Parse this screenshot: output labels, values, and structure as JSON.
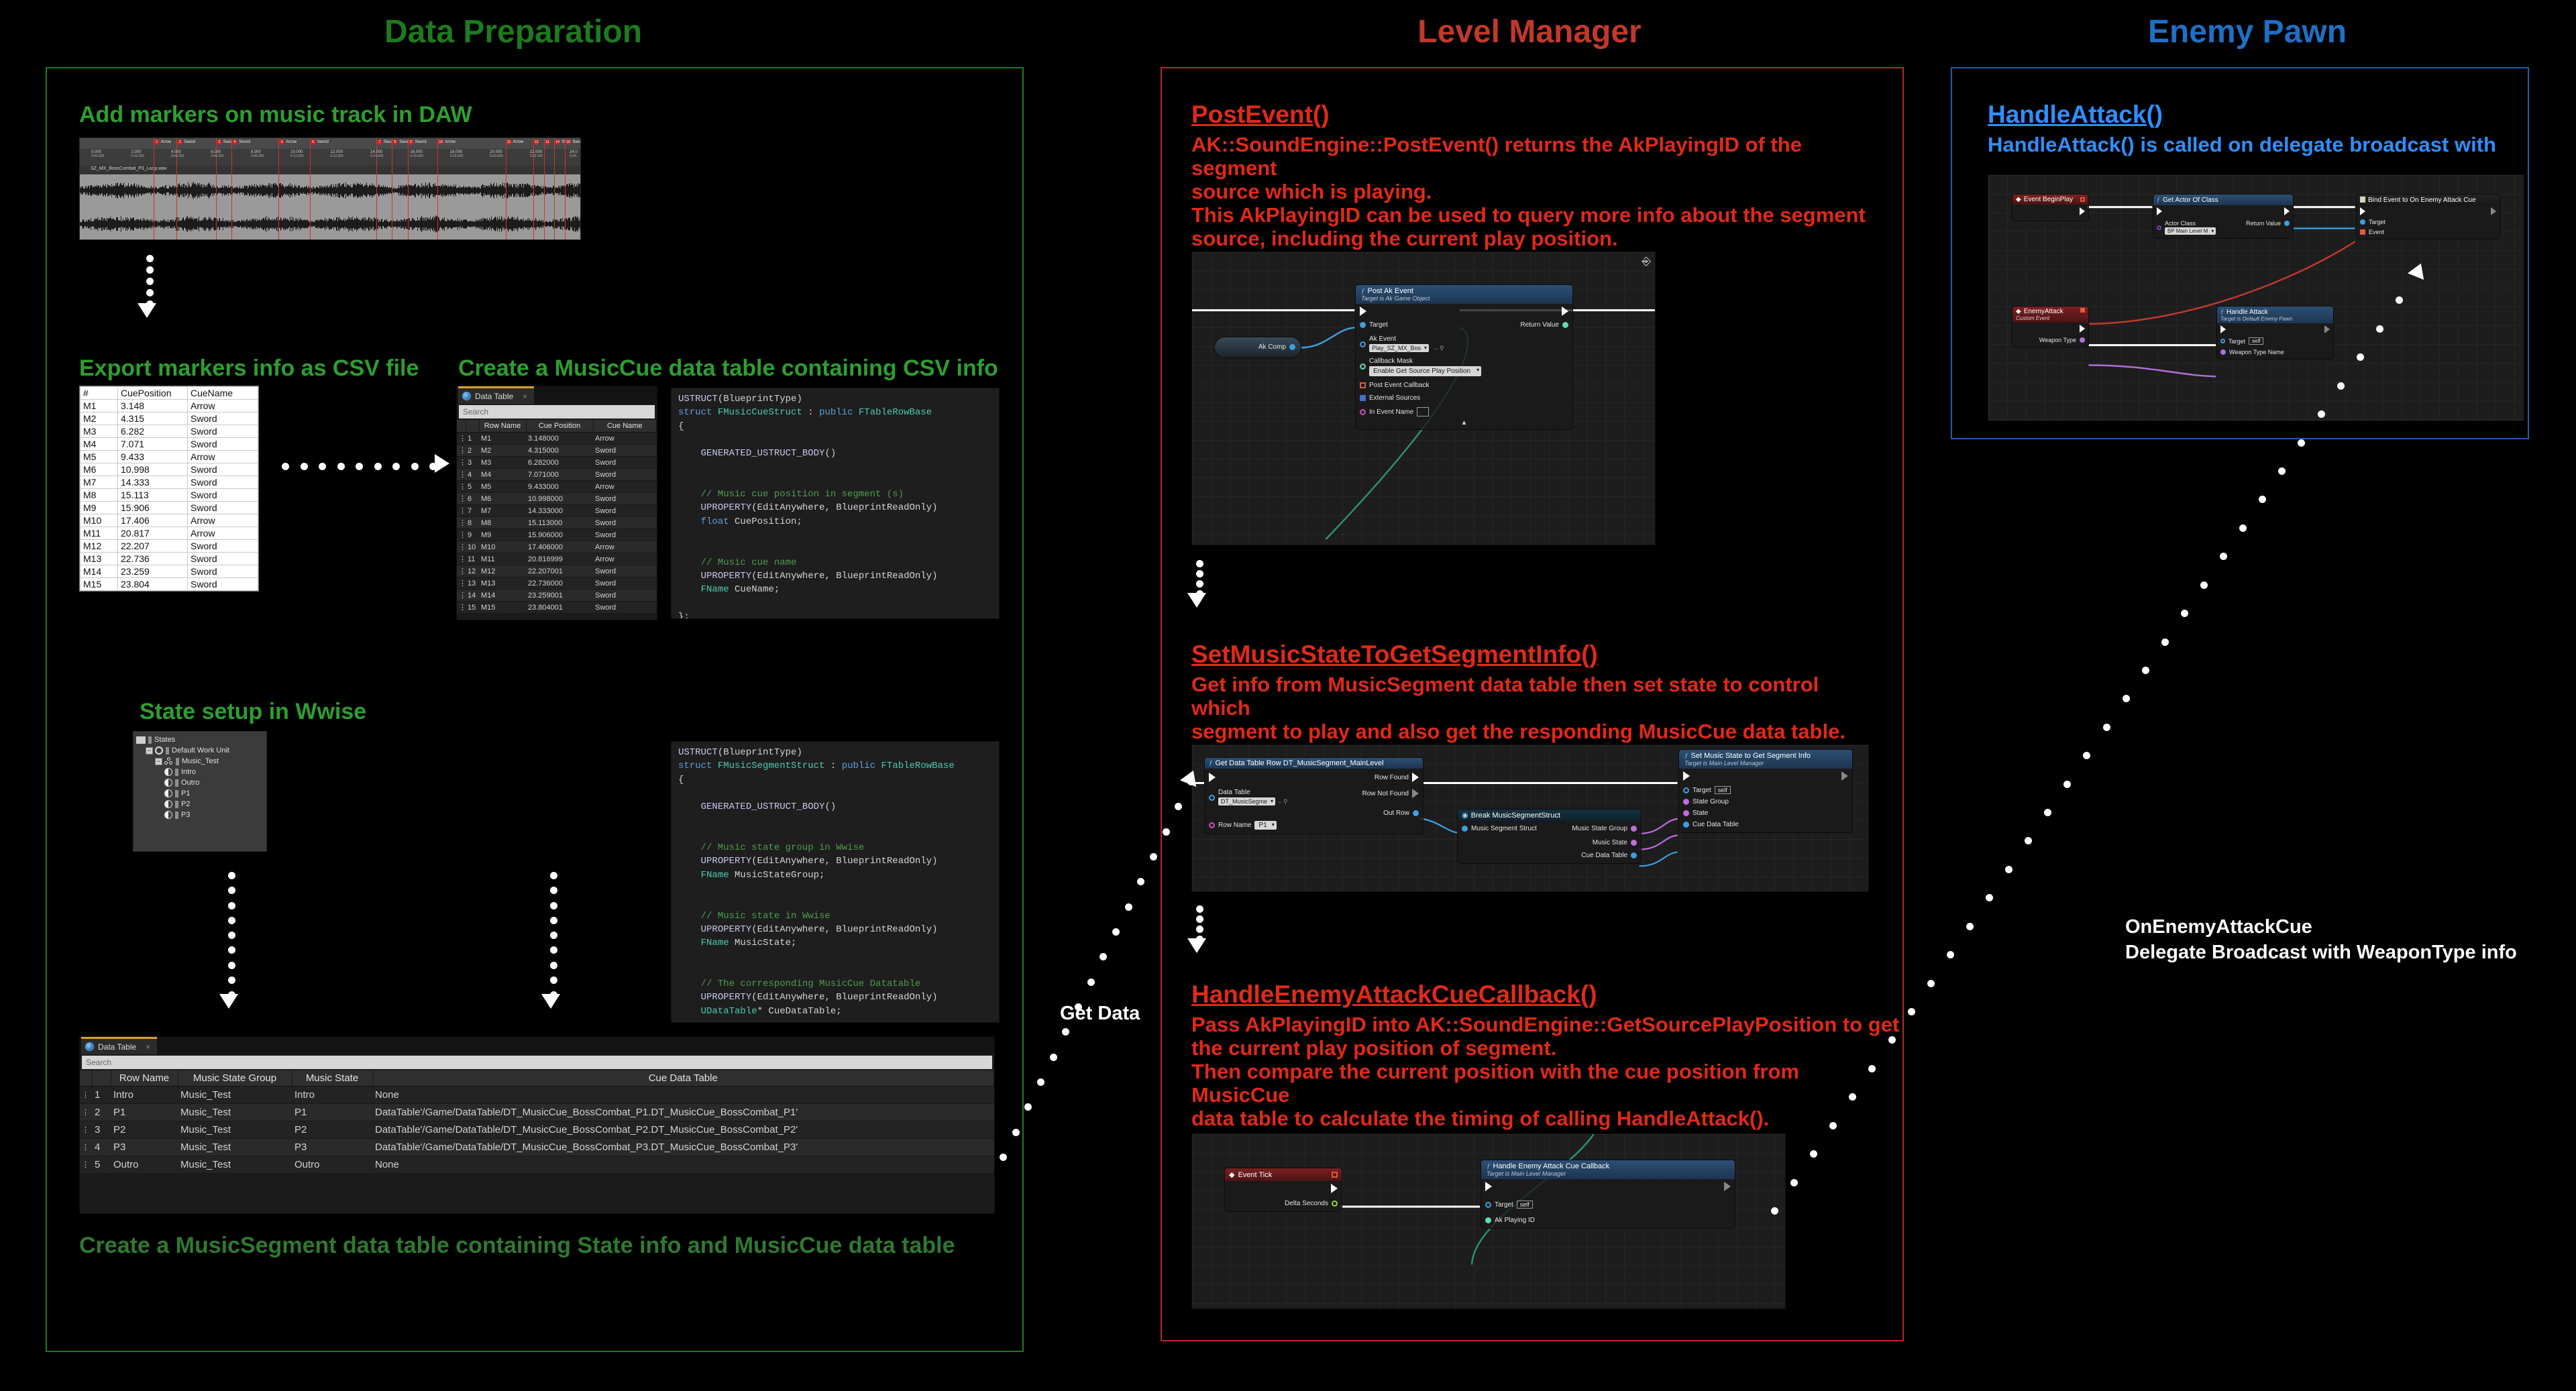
{
  "columns": {
    "data_prep": {
      "title": "Data Preparation",
      "color": "#1e7a1e"
    },
    "level_manager": {
      "title": "Level Manager",
      "color": "#c0392b"
    },
    "enemy_pawn": {
      "title": "Enemy Pawn",
      "color": "#1f6fc4"
    }
  },
  "data_prep": {
    "heading_daw": "Add markers on music track in DAW",
    "heading_export": "Export markers info as CSV file",
    "heading_create_cue_dt": "Create a MusicCue data table containing CSV info",
    "heading_state_setup": "State setup in Wwise",
    "caption_segment_dt": "Create a MusicSegment data table containing State info and MusicCue data table",
    "daw": {
      "filename": "SZ_MX_BossCombat_P3_Loop.wav",
      "time_ticks": [
        "0.000",
        "2.000",
        "4.000",
        "6.000",
        "8.000",
        "10.000",
        "12.000",
        "14.000",
        "16.000",
        "18.000",
        "20.000",
        "22.000",
        "24.0"
      ],
      "time_subticks": [
        "0:00.000",
        "0:02.000",
        "0:04.000",
        "0:06.000",
        "0:08.000",
        "0:10.000",
        "0:12.000",
        "0:14.000",
        "0:16.000",
        "0:18.000",
        "0:20.000",
        "0:22.000",
        "0:24."
      ],
      "markers": [
        {
          "n": "1",
          "name": "Arrow",
          "pos": 3.148
        },
        {
          "n": "2",
          "name": "Sword",
          "pos": 4.315
        },
        {
          "n": "3",
          "name": "Sword",
          "pos": 6.282
        },
        {
          "n": "4",
          "name": "Sword",
          "pos": 7.071
        },
        {
          "n": "5",
          "name": "Arrow",
          "pos": 9.433
        },
        {
          "n": "6",
          "name": "Sword",
          "pos": 10.998
        },
        {
          "n": "7",
          "name": "Sword",
          "pos": 14.333
        },
        {
          "n": "8",
          "name": "Sword",
          "pos": 15.113
        },
        {
          "n": "9",
          "name": "Sword",
          "pos": 15.906
        },
        {
          "n": "10",
          "name": "Arrow",
          "pos": 17.406
        },
        {
          "n": "11",
          "name": "Arrow",
          "pos": 20.817
        },
        {
          "n": "12",
          "name": "",
          "pos": 22.207
        },
        {
          "n": "13",
          "name": "",
          "pos": 22.736
        },
        {
          "n": "14",
          "name": "Sw",
          "pos": 23.259
        },
        {
          "n": "15",
          "name": "Swo",
          "pos": 23.804
        }
      ]
    },
    "csv": {
      "headers": [
        "#",
        "CuePosition",
        "CueName"
      ],
      "rows": [
        [
          "M1",
          "3.148",
          "Arrow"
        ],
        [
          "M2",
          "4.315",
          "Sword"
        ],
        [
          "M3",
          "6.282",
          "Sword"
        ],
        [
          "M4",
          "7.071",
          "Sword"
        ],
        [
          "M5",
          "9.433",
          "Arrow"
        ],
        [
          "M6",
          "10.998",
          "Sword"
        ],
        [
          "M7",
          "14.333",
          "Sword"
        ],
        [
          "M8",
          "15.113",
          "Sword"
        ],
        [
          "M9",
          "15.906",
          "Sword"
        ],
        [
          "M10",
          "17.406",
          "Arrow"
        ],
        [
          "M11",
          "20.817",
          "Arrow"
        ],
        [
          "M12",
          "22.207",
          "Sword"
        ],
        [
          "M13",
          "22.736",
          "Sword"
        ],
        [
          "M14",
          "23.259",
          "Sword"
        ],
        [
          "M15",
          "23.804",
          "Sword"
        ]
      ]
    },
    "cue_datatable": {
      "tab_label": "Data Table",
      "search_placeholder": "Search",
      "headers": [
        "Row Name",
        "Cue Position",
        "Cue Name"
      ],
      "rows": [
        [
          "1",
          "M1",
          "3.148000",
          "Arrow"
        ],
        [
          "2",
          "M2",
          "4.315000",
          "Sword"
        ],
        [
          "3",
          "M3",
          "6.282000",
          "Sword"
        ],
        [
          "4",
          "M4",
          "7.071000",
          "Sword"
        ],
        [
          "5",
          "M5",
          "9.433000",
          "Arrow"
        ],
        [
          "6",
          "M6",
          "10.998000",
          "Sword"
        ],
        [
          "7",
          "M7",
          "14.333000",
          "Sword"
        ],
        [
          "8",
          "M8",
          "15.113000",
          "Sword"
        ],
        [
          "9",
          "M9",
          "15.906000",
          "Sword"
        ],
        [
          "10",
          "M10",
          "17.406000",
          "Arrow"
        ],
        [
          "11",
          "M11",
          "20.816999",
          "Arrow"
        ],
        [
          "12",
          "M12",
          "22.207001",
          "Sword"
        ],
        [
          "13",
          "M13",
          "22.736000",
          "Sword"
        ],
        [
          "14",
          "M14",
          "23.259001",
          "Sword"
        ],
        [
          "15",
          "M15",
          "23.804001",
          "Sword"
        ]
      ]
    },
    "segment_datatable": {
      "tab_label": "Data Table",
      "search_placeholder": "Search",
      "headers": [
        "Row Name",
        "Music State Group",
        "Music State",
        "Cue Data Table"
      ],
      "rows": [
        [
          "1",
          "Intro",
          "Music_Test",
          "Intro",
          "None"
        ],
        [
          "2",
          "P1",
          "Music_Test",
          "P1",
          "DataTable'/Game/DataTable/DT_MusicCue_BossCombat_P1.DT_MusicCue_BossCombat_P1'"
        ],
        [
          "3",
          "P2",
          "Music_Test",
          "P2",
          "DataTable'/Game/DataTable/DT_MusicCue_BossCombat_P2.DT_MusicCue_BossCombat_P2'"
        ],
        [
          "4",
          "P3",
          "Music_Test",
          "P3",
          "DataTable'/Game/DataTable/DT_MusicCue_BossCombat_P3.DT_MusicCue_BossCombat_P3'"
        ],
        [
          "5",
          "Outro",
          "Music_Test",
          "Outro",
          "None"
        ]
      ]
    },
    "wwise_tree": [
      {
        "label": "States",
        "icon": "folder-icon",
        "depth": 0
      },
      {
        "label": "Default Work Unit",
        "icon": "work-unit-icon",
        "depth": 1
      },
      {
        "label": "Music_Test",
        "icon": "state-group-icon",
        "depth": 2
      },
      {
        "label": "Intro",
        "icon": "state-icon",
        "depth": 3
      },
      {
        "label": "Outro",
        "icon": "state-icon",
        "depth": 3
      },
      {
        "label": "P1",
        "icon": "state-icon",
        "depth": 3
      },
      {
        "label": "P2",
        "icon": "state-icon",
        "depth": 3
      },
      {
        "label": "P3",
        "icon": "state-icon",
        "depth": 3
      }
    ],
    "code_cue_struct": "USTRUCT(BlueprintType)\nstruct FMusicCueStruct : public FTableRowBase\n{\n\n    GENERATED_USTRUCT_BODY()\n\n\n    // Music cue position in segment (s)\n    UPROPERTY(EditAnywhere, BlueprintReadOnly)\n    float CuePosition;\n\n\n    // Music cue name\n    UPROPERTY(EditAnywhere, BlueprintReadOnly)\n    FName CueName;\n\n};",
    "code_segment_struct": "USTRUCT(BlueprintType)\nstruct FMusicSegmentStruct : public FTableRowBase\n{\n\n    GENERATED_USTRUCT_BODY()\n\n\n    // Music state group in Wwise\n    UPROPERTY(EditAnywhere, BlueprintReadOnly)\n    FName MusicStateGroup;\n\n\n    // Music state in Wwise\n    UPROPERTY(EditAnywhere, BlueprintReadOnly)\n    FName MusicState;\n\n\n    // The corresponding MusicCue Datatable\n    UPROPERTY(EditAnywhere, BlueprintReadOnly)\n    UDataTable* CueDataTable;\n\n};"
  },
  "level_manager": {
    "post_event": {
      "title": "PostEvent()",
      "line1": "AK::SoundEngine::PostEvent() returns the AkPlayingID of the segment",
      "line2": "source which is playing.",
      "line3": "This AkPlayingID can be used to query more info about the segment",
      "line4": "source, including the current play position."
    },
    "post_event_graph": {
      "var_node": "Ak Comp",
      "node_title": "Post Ak Event",
      "node_subtitle": "Target is Ak Game Object",
      "pins": {
        "target": "Target",
        "return_value": "Return Value",
        "ak_event": "Ak Event",
        "ak_event_value": "Play_SZ_MX_Bos",
        "callback_mask": "Callback Mask",
        "callback_mask_value": "Enable Get Source Play Position",
        "post_event_callback": "Post Event Callback",
        "external_sources": "External Sources",
        "in_event_name": "In Event Name"
      }
    },
    "set_state": {
      "title": "SetMusicStateToGetSegmentInfo()",
      "line1": "Get info from MusicSegment data table then set state to control which",
      "line2": "segment to play and also get the responding MusicCue data table."
    },
    "set_state_graph": {
      "node1_title": "Get Data Table Row DT_MusicSegment_MainLevel",
      "node1_pins": {
        "data_table": "Data Table",
        "data_table_value": "DT_MusicSegme",
        "row_name": "Row Name",
        "row_name_value": "P1",
        "row_found": "Row Found",
        "row_not_found": "Row Not Found",
        "out_row": "Out Row"
      },
      "node2_title": "Break MusicSegmentStruct",
      "node2_pins": {
        "in": "Music Segment Struct",
        "out1": "Music State Group",
        "out2": "Music State",
        "out3": "Cue Data Table"
      },
      "node3_title": "Set Music State to Get Segment Info",
      "node3_subtitle": "Target is Main Level Manager",
      "node3_pins": {
        "target": "Target",
        "target_value": "self",
        "state_group": "State Group",
        "state": "State",
        "cue_data_table": "Cue Data Table"
      }
    },
    "handle_cue": {
      "title": "HandleEnemyAttackCueCallback()",
      "line1": "Pass AkPlayingID into AK::SoundEngine::GetSourcePlayPosition to get",
      "line2": "the current play position of segment.",
      "line3": "Then compare the current position with the cue position from MusicCue",
      "line4": "data table to calculate the timing of calling HandleAttack()."
    },
    "handle_cue_graph": {
      "event_node": "Event Tick",
      "event_pin": "Delta Seconds",
      "node_title": "Handle Enemy Attack Cue Callback",
      "node_subtitle": "Target is Main Level Manager",
      "pins": {
        "target": "Target",
        "target_value": "self",
        "ak_playing_id": "Ak Playing ID"
      }
    }
  },
  "enemy_pawn": {
    "handle_attack": {
      "title": "HandleAttack()",
      "line1": "HandleAttack() is called on delegate broadcast with"
    },
    "graph": {
      "n1_title": "Event BeginPlay",
      "n2_title": "Get Actor Of Class",
      "n2_pins": {
        "actor_class": "Actor Class",
        "actor_class_value": "BP Main Level M",
        "return_value": "Return Value"
      },
      "n3_title": "Bind Event to On Enemy Attack Cue",
      "n3_pins": {
        "target": "Target",
        "event": "Event"
      },
      "n4_title": "EnemyAttack",
      "n4_subtitle": "Custom Event",
      "n4_pins": {
        "weapon_type": "Weapon Type"
      },
      "n5_title": "Handle Attack",
      "n5_subtitle": "Target is Default Enemy Pawn",
      "n5_pins": {
        "target": "Target",
        "target_value": "self",
        "weapon_type_name": "Weapon Type Name"
      }
    }
  },
  "annotations": {
    "get_data": "Get Data",
    "delegate_line1": "OnEnemyAttackCue",
    "delegate_line2": "Delegate Broadcast with WeaponType info"
  }
}
